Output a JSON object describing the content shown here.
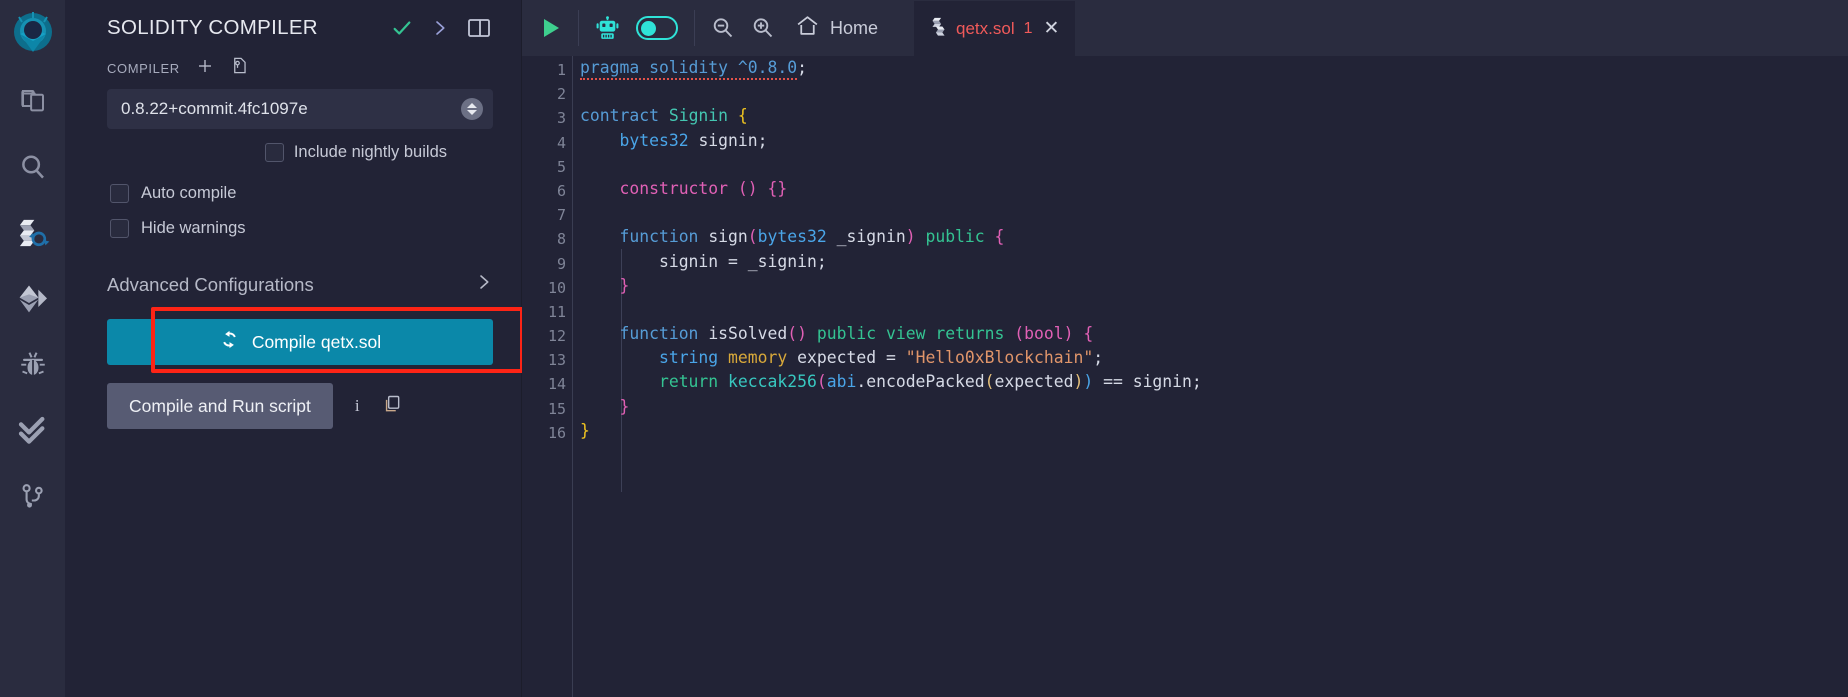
{
  "theme": {
    "bg": "#222336",
    "panel_bg": "#222336",
    "iconbar_bg": "#2a2c3f",
    "accent_teal": "#0b88a9",
    "accent_cyan": "#2fe3d8",
    "highlight_red": "#fd2416",
    "tab_red": "#f05a5a",
    "check_green": "#34c392"
  },
  "iconbar": {
    "logo_name": "remix-logo-icon",
    "items": [
      {
        "name": "file-explorer-icon",
        "label": "File explorer"
      },
      {
        "name": "search-icon",
        "label": "Search in files"
      },
      {
        "name": "solidity-compiler-icon",
        "label": "Solidity compiler"
      },
      {
        "name": "deploy-run-icon",
        "label": "Deploy & run transactions"
      },
      {
        "name": "debugger-icon",
        "label": "Debugger"
      },
      {
        "name": "solidity-analyzers-icon",
        "label": "Solidity analyzers"
      },
      {
        "name": "git-icon",
        "label": "Git"
      }
    ]
  },
  "panel": {
    "title": "SOLIDITY COMPILER",
    "header_icons": [
      {
        "name": "check-icon",
        "label": "Compilation successful"
      },
      {
        "name": "chevron-right-icon",
        "label": "Collapse"
      },
      {
        "name": "panel-layout-icon",
        "label": "Toggle panel"
      }
    ],
    "compiler_label": "COMPILER",
    "add_icon": "plus-icon",
    "custom_icon": "add-custom-compiler-icon",
    "version_select": {
      "value": "0.8.22+commit.4fc1097e",
      "stepper_icon": "stepper-up-down-icon"
    },
    "nightly": {
      "label": "Include nightly builds",
      "checked": false
    },
    "options": [
      {
        "label": "Auto compile",
        "checked": false,
        "name": "auto-compile"
      },
      {
        "label": "Hide warnings",
        "checked": false,
        "name": "hide-warnings"
      }
    ],
    "advanced": {
      "label": "Advanced Configurations",
      "chevron": "chevron-right-icon"
    },
    "compile_button": {
      "label": "Compile qetx.sol",
      "icon": "refresh-icon",
      "highlighted": true
    },
    "run_button": {
      "label": "Compile and Run script"
    },
    "run_info_icon": "info-icon",
    "run_copy_icon": "copy-icon"
  },
  "toolbar": {
    "run_icon": "play-icon",
    "ai_icon": "robot-icon",
    "ai_toggle": {
      "name": "ai-toggle",
      "on": true
    },
    "zoom_out_icon": "zoom-out-icon",
    "zoom_in_icon": "zoom-in-icon",
    "home_icon": "home-icon",
    "home_label": "Home",
    "tabs": [
      {
        "file_icon": "solidity-file-icon",
        "name": "qetx.sol",
        "badge": "1",
        "close_icon": "close-icon",
        "active": true
      }
    ]
  },
  "editor": {
    "line_numbers": [
      1,
      2,
      3,
      4,
      5,
      6,
      7,
      8,
      9,
      10,
      11,
      12,
      13,
      14,
      15,
      16
    ],
    "active_line": 7,
    "lines": [
      "pragma solidity ^0.8.0;",
      "",
      "contract Signin {",
      "    bytes32 signin;",
      "",
      "    constructor () {}",
      "",
      "    function sign(bytes32 _signin) public {",
      "        signin = _signin;",
      "    }",
      "",
      "    function isSolved() public view returns (bool) {",
      "        string memory expected = \"Hello0xBlockchain\";",
      "        return keccak256(abi.encodePacked(expected)) == signin;",
      "    }",
      "}"
    ],
    "language": "solidity",
    "has_error_squiggle_on_line": 1
  }
}
